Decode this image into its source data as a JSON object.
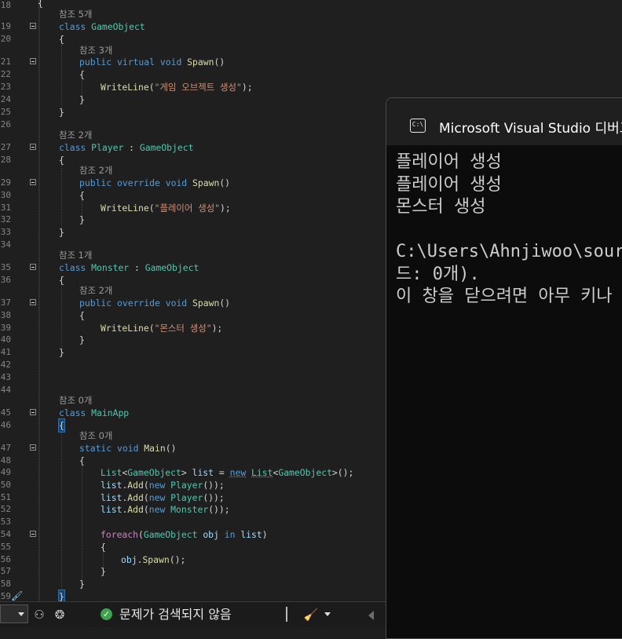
{
  "editor": {
    "lines": [
      {
        "n": "18",
        "code": "{"
      },
      {
        "lens": "참조 5개"
      },
      {
        "n": "19",
        "code": "class GameObject"
      },
      {
        "n": "20",
        "code": "{"
      },
      {
        "lens": "참조 3개"
      },
      {
        "n": "21",
        "code": "public virtual void Spawn()"
      },
      {
        "n": "22",
        "code": "{"
      },
      {
        "n": "23",
        "code": "WriteLine(\"게임 오브젝트 생성\");"
      },
      {
        "n": "24",
        "code": "}"
      },
      {
        "n": "25",
        "code": "}"
      },
      {
        "n": "26",
        "code": ""
      },
      {
        "lens": "참조 2개"
      },
      {
        "n": "27",
        "code": "class Player : GameObject"
      },
      {
        "n": "28",
        "code": "{"
      },
      {
        "lens": "참조 2개"
      },
      {
        "n": "29",
        "code": "public override void Spawn()"
      },
      {
        "n": "30",
        "code": "{"
      },
      {
        "n": "31",
        "code": "WriteLine(\"플레이어 생성\");"
      },
      {
        "n": "32",
        "code": "}"
      },
      {
        "n": "33",
        "code": "}"
      },
      {
        "n": "34",
        "code": ""
      },
      {
        "lens": "참조 1개"
      },
      {
        "n": "35",
        "code": "class Monster : GameObject"
      },
      {
        "n": "36",
        "code": "{"
      },
      {
        "lens": "참조 2개"
      },
      {
        "n": "37",
        "code": "public override void Spawn()"
      },
      {
        "n": "38",
        "code": "{"
      },
      {
        "n": "39",
        "code": "WriteLine(\"몬스터 생성\");"
      },
      {
        "n": "40",
        "code": "}"
      },
      {
        "n": "41",
        "code": "}"
      },
      {
        "n": "42",
        "code": ""
      },
      {
        "n": "43",
        "code": ""
      },
      {
        "n": "44",
        "code": ""
      },
      {
        "lens": "참조 0개"
      },
      {
        "n": "45",
        "code": "class MainApp"
      },
      {
        "n": "46",
        "code": "{"
      },
      {
        "lens": "참조 0개"
      },
      {
        "n": "47",
        "code": "static void Main()"
      },
      {
        "n": "48",
        "code": "{"
      },
      {
        "n": "49",
        "code": "List<GameObject> list = new List<GameObject>();"
      },
      {
        "n": "50",
        "code": "list.Add(new Player());"
      },
      {
        "n": "51",
        "code": "list.Add(new Player());"
      },
      {
        "n": "52",
        "code": "list.Add(new Monster());"
      },
      {
        "n": "53",
        "code": ""
      },
      {
        "n": "54",
        "code": "foreach(GameObject obj in list)"
      },
      {
        "n": "55",
        "code": "{"
      },
      {
        "n": "56",
        "code": "obj.Spawn();"
      },
      {
        "n": "57",
        "code": "}"
      },
      {
        "n": "58",
        "code": "}"
      },
      {
        "n": "59",
        "code": "}"
      }
    ]
  },
  "statusbar": {
    "issues_text": "문제가 검색되지 않음",
    "icons": [
      "zoom-dropdown",
      "copilot-icon",
      "agent-icon",
      "check-circle-icon",
      "cleanup-brush-icon",
      "chevron-down-icon",
      "scroll-left-icon"
    ]
  },
  "console": {
    "title": "Microsoft Visual Studio 디버그 콘솔",
    "icon_text": "C:\\",
    "output": [
      "플레이어 생성",
      "플레이어 생성",
      "몬스터 생성",
      "",
      "C:\\Users\\Ahnjiwoo\\source\\repos",
      "드: 0개).",
      "이 창을 닫으려면 아무 키나 누르세요..."
    ]
  },
  "colors": {
    "editor_bg": "#1f1f1f",
    "keyword": "#569cd6",
    "type": "#4ec9b0",
    "method": "#dcdcaa",
    "string": "#ce9178",
    "variable": "#9cdcfe",
    "control": "#c586c0",
    "console_bg": "#0c0c0c"
  }
}
